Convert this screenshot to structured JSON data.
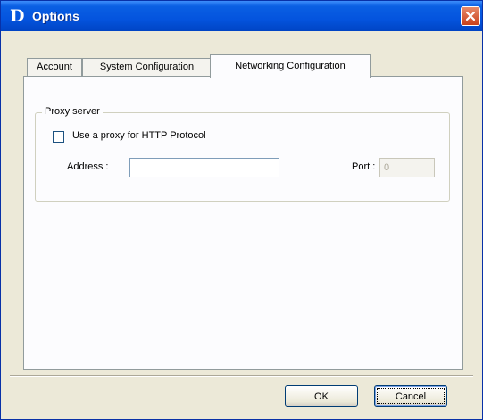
{
  "window": {
    "logo_letter": "D",
    "title": "Options",
    "close_icon": "close-x-icon"
  },
  "tabs": [
    {
      "label": "Account",
      "active": false
    },
    {
      "label": "System Configuration",
      "active": false
    },
    {
      "label": "Networking Configuration",
      "active": true
    }
  ],
  "proxy": {
    "group_label": "Proxy server",
    "checkbox_label": "Use a proxy for HTTP Protocol",
    "checkbox_checked": false,
    "address_label": "Address :",
    "address_value": "",
    "port_label": "Port :",
    "port_value": "0"
  },
  "buttons": {
    "ok_label": "OK",
    "cancel_label": "Cancel"
  },
  "colors": {
    "titlebar": "#0454de",
    "dialog_bg": "#ece9d8",
    "close_button": "#c9401a"
  }
}
